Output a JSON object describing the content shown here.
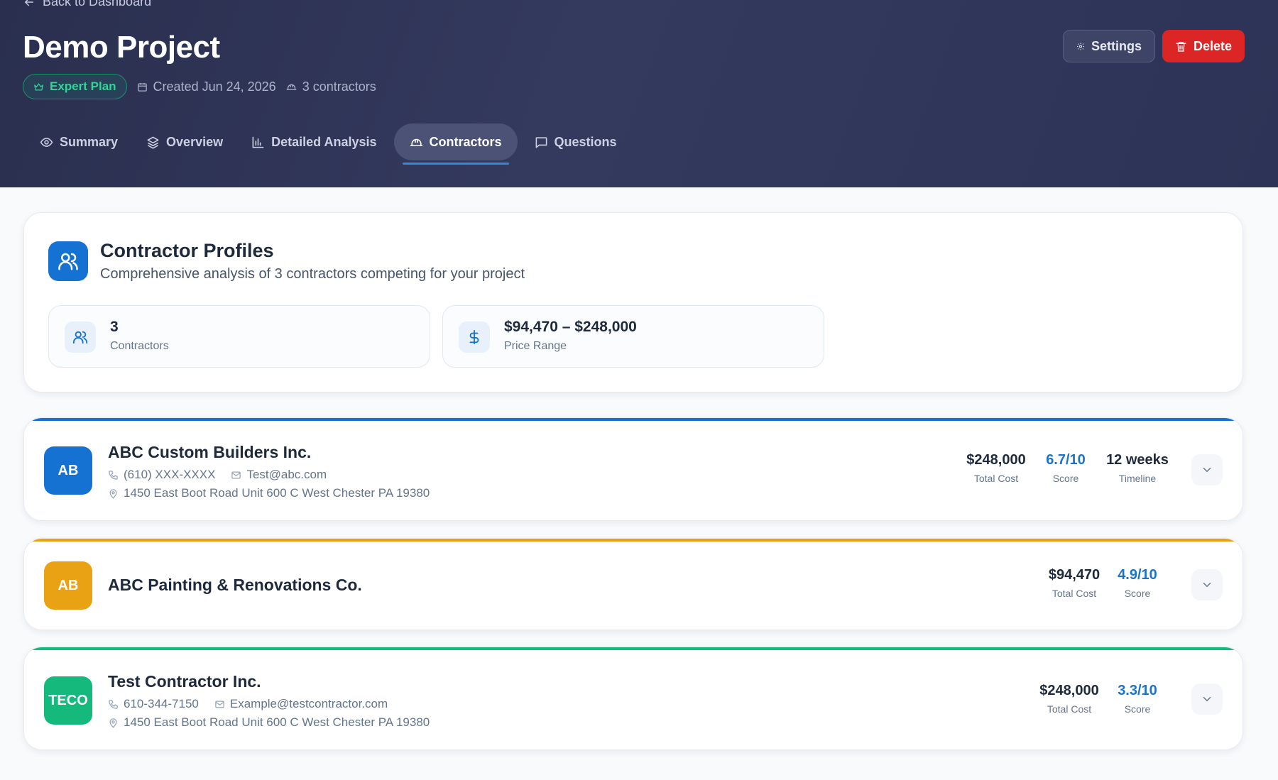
{
  "header": {
    "back_label": "Back to Dashboard",
    "title": "Demo Project",
    "plan_badge": "Expert Plan",
    "created": "Created Jun 24, 2026",
    "contractors_count": "3 contractors",
    "settings_label": "Settings",
    "delete_label": "Delete"
  },
  "tabs": [
    {
      "label": "Summary",
      "icon": "eye-icon"
    },
    {
      "label": "Overview",
      "icon": "layers-icon"
    },
    {
      "label": "Detailed Analysis",
      "icon": "bar-chart-icon"
    },
    {
      "label": "Contractors",
      "icon": "hard-hat-icon",
      "active": true
    },
    {
      "label": "Questions",
      "icon": "message-square-icon"
    }
  ],
  "profiles": {
    "title": "Contractor Profiles",
    "subtitle": "Comprehensive analysis of 3 contractors competing for your project",
    "stats": [
      {
        "value": "3",
        "label": "Contractors",
        "icon": "users-icon"
      },
      {
        "value": "$94,470 – $248,000",
        "label": "Price Range",
        "icon": "dollar-icon"
      }
    ]
  },
  "contractors": [
    {
      "initials": "AB",
      "name": "ABC Custom Builders Inc.",
      "phone": "(610) XXX-XXXX",
      "email": "Test@abc.com",
      "address": "1450 East Boot Road Unit 600 C West Chester PA 19380",
      "total_cost": "$248,000",
      "total_cost_label": "Total Cost",
      "score": "6.7/10",
      "score_label": "Score",
      "timeline": "12 weeks",
      "timeline_label": "Timeline",
      "color": "#1572d3"
    },
    {
      "initials": "AB",
      "name": "ABC Painting & Renovations Co.",
      "total_cost": "$94,470",
      "total_cost_label": "Total Cost",
      "score": "4.9/10",
      "score_label": "Score",
      "color": "#eaa215"
    },
    {
      "initials": "TECO",
      "name": "Test Contractor Inc.",
      "phone": "610-344-7150",
      "email": "Example@testcontractor.com",
      "address": "1450 East Boot Road Unit 600 C West Chester PA 19380",
      "total_cost": "$248,000",
      "total_cost_label": "Total Cost",
      "score": "3.3/10",
      "score_label": "Score",
      "color": "#16b97c"
    }
  ],
  "colors": {
    "header_bg": "#2f3558",
    "accent_blue": "#1572d3",
    "danger": "#dc2626",
    "success": "#34d399"
  }
}
